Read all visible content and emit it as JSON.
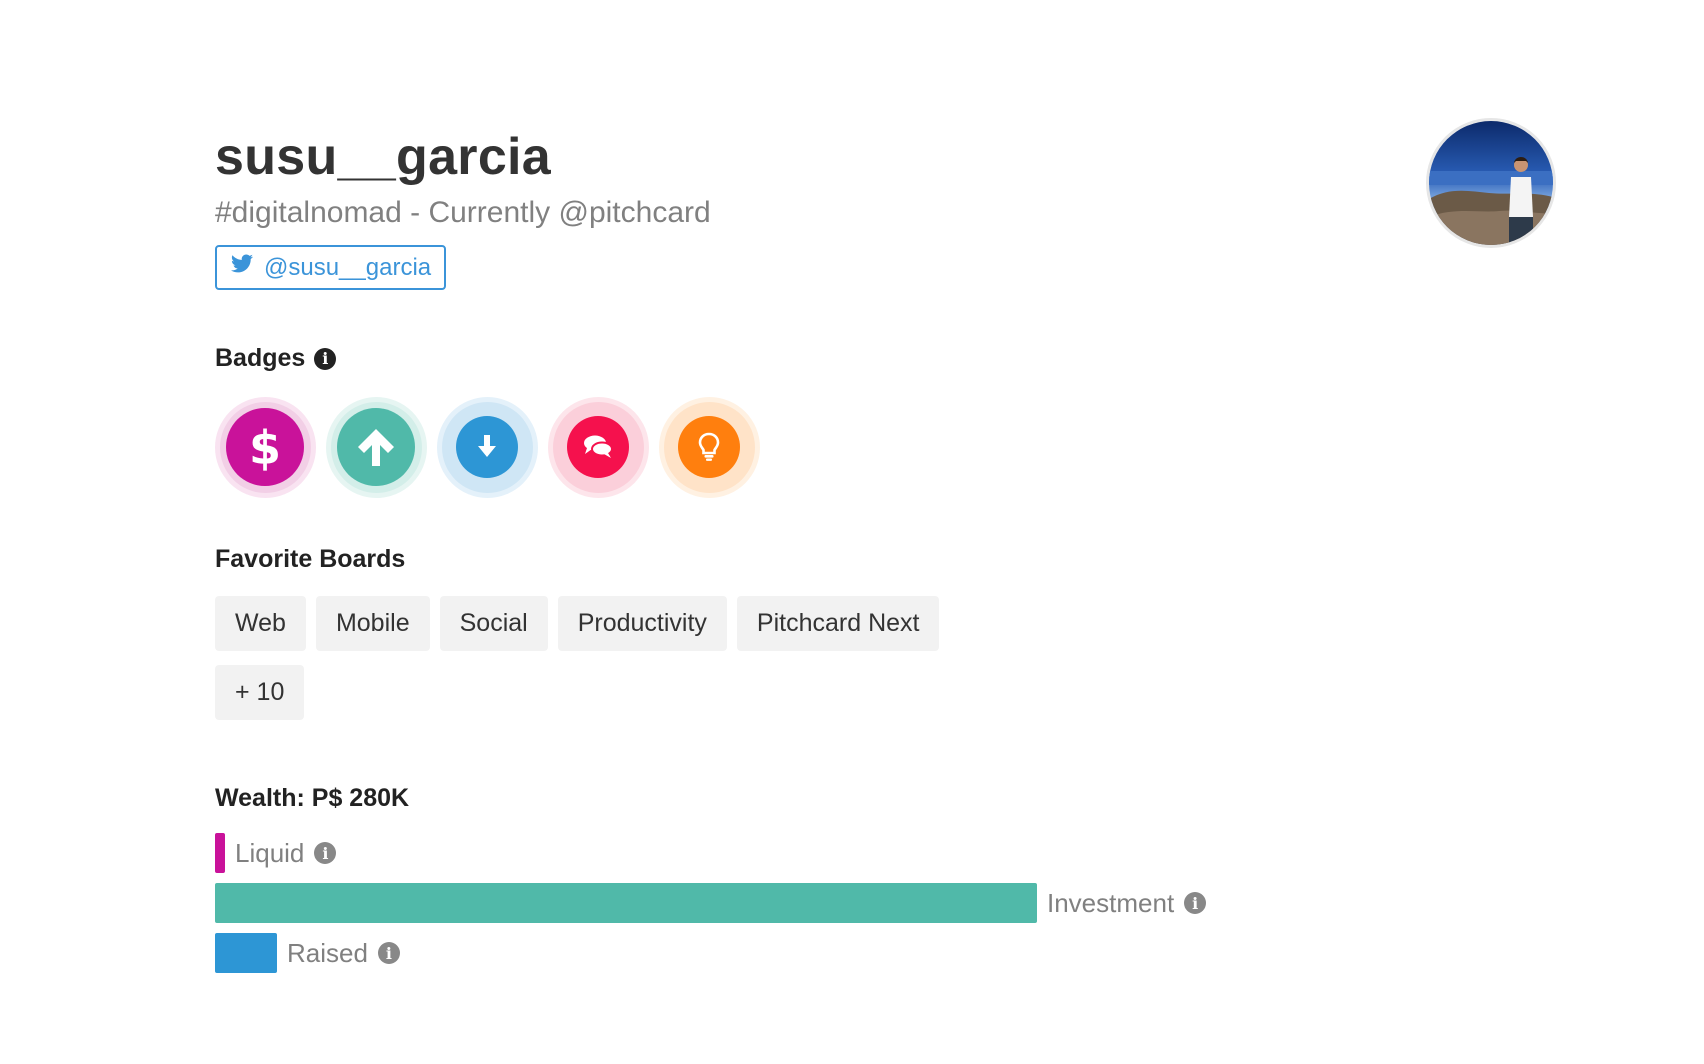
{
  "profile": {
    "username": "susu__garcia",
    "bio": "#digitalnomad - Currently @pitchcard",
    "twitter_handle": "@susu__garcia"
  },
  "badges": {
    "title": "Badges",
    "info_icon": "info-circle-icon",
    "items": [
      {
        "icon": "dollar-icon",
        "color": "#c9129a",
        "ring": "#f2cfe6"
      },
      {
        "icon": "arrow-up-icon",
        "color": "#50b9a9",
        "ring": "#d3eee9"
      },
      {
        "icon": "arrow-down-circle-icon",
        "color": "#2d96d5",
        "ring": "#d2e8f6"
      },
      {
        "icon": "comments-icon",
        "color": "#f5114d",
        "ring": "#fcd3dd"
      },
      {
        "icon": "lightbulb-icon",
        "color": "#ff7f0e",
        "ring": "#ffe6cc"
      }
    ]
  },
  "boards": {
    "title": "Favorite Boards",
    "items": [
      "Web",
      "Mobile",
      "Social",
      "Productivity",
      "Pitchcard Next",
      "+ 10"
    ]
  },
  "wealth": {
    "title": "Wealth: P$ 280K",
    "bars": [
      {
        "label": "Liquid",
        "fraction": 0.012,
        "color": "#c9129a"
      },
      {
        "label": "Investment",
        "fraction": 1.0,
        "color": "#50b9a9"
      },
      {
        "label": "Raised",
        "fraction": 0.075,
        "color": "#2d96d5"
      }
    ]
  },
  "colors": {
    "twitter": "#3b94d9",
    "text_dark": "#333333",
    "text_muted": "#808080",
    "chip_bg": "#f2f2f2"
  }
}
